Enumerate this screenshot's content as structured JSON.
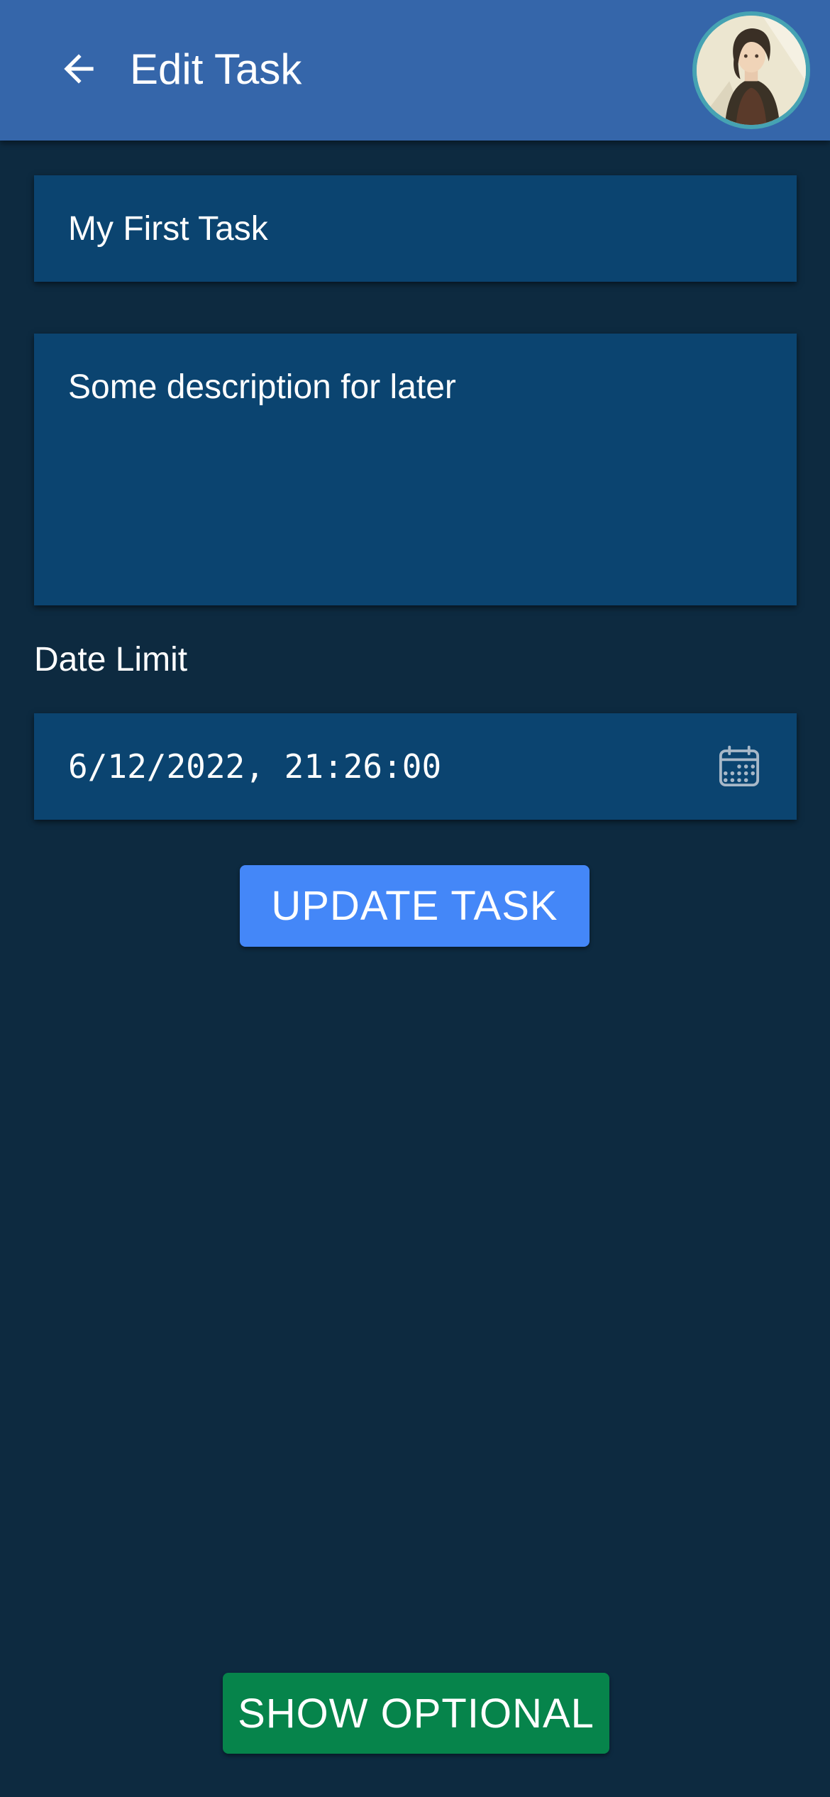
{
  "theme": {
    "background": "#0d2a40",
    "appbar": "#3566aa",
    "field_background": "#0b4470",
    "primary_button": "#4487f8",
    "secondary_button": "#06844b",
    "avatar_border": "#46a3b3"
  },
  "appbar": {
    "back_icon": "arrow-left-icon",
    "title": "Edit Task",
    "avatar": "user-avatar"
  },
  "form": {
    "title_value": "My First Task",
    "description_value": "Some description for later",
    "date_label": "Date Limit",
    "date_value": "6/12/2022, 21:26:00",
    "calendar_icon": "calendar-icon",
    "update_button": "UPDATE TASK"
  },
  "footer": {
    "show_optional_button": "SHOW OPTIONAL"
  }
}
